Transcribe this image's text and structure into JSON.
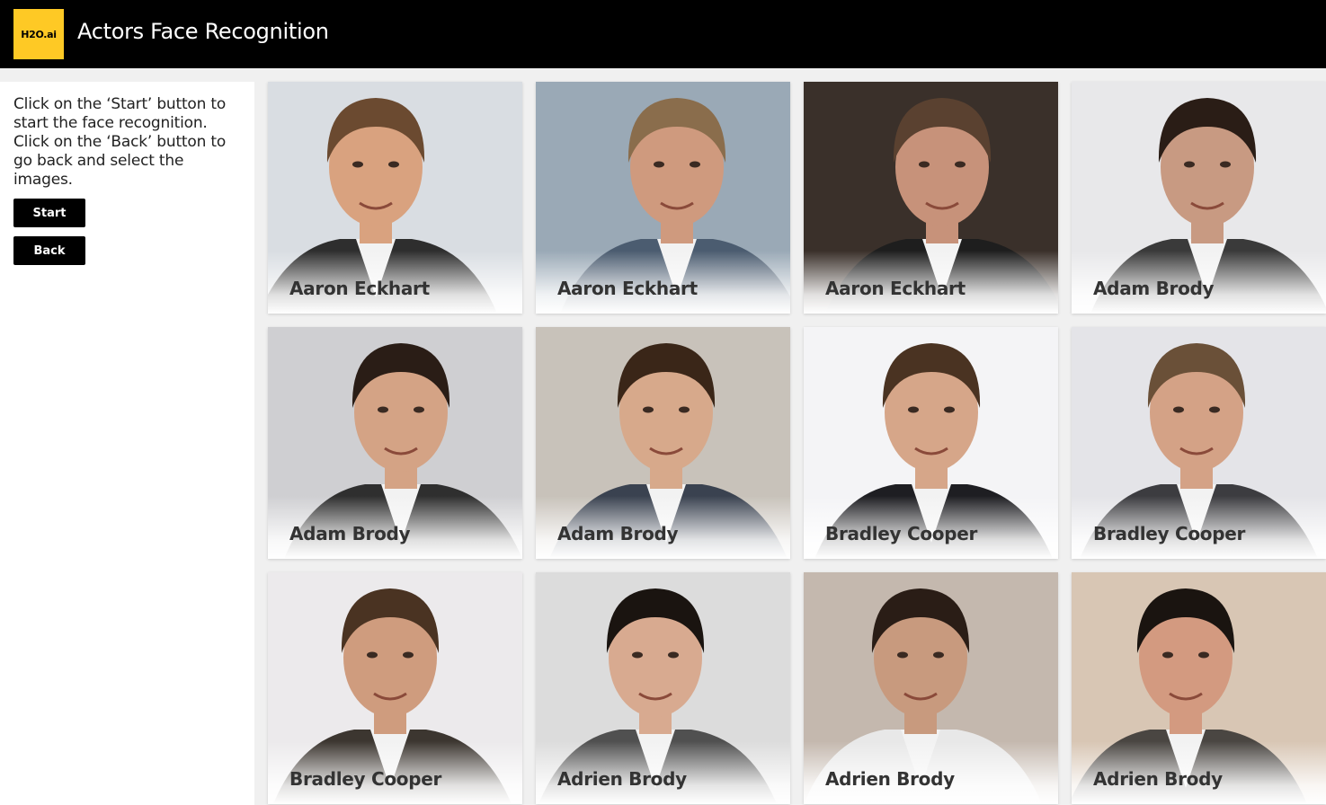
{
  "header": {
    "logo_text": "H2O.ai",
    "title": "Actors Face Recognition",
    "colors": {
      "background": "#000000",
      "logo": "#fec925"
    }
  },
  "sidebar": {
    "instructions": [
      "Click on the ‘Start’ button to start the face recognition.",
      "Click on the ‘Back’ button to go back and select the images."
    ],
    "start_label": "Start",
    "back_label": "Back"
  },
  "gallery": {
    "cards": [
      {
        "name": "Aaron Eckhart",
        "bg": "#d9dde2",
        "skin": "#d9a27f",
        "hair": "#6b4a30",
        "suit": "#2e2e2e"
      },
      {
        "name": "Aaron Eckhart",
        "bg": "#9aa9b6",
        "skin": "#cf9a7e",
        "hair": "#8a6d4c",
        "suit": "#4b5c70"
      },
      {
        "name": "Aaron Eckhart",
        "bg": "#3a302a",
        "skin": "#c7927a",
        "hair": "#5a4130",
        "suit": "#1e1e1e"
      },
      {
        "name": "Adam Brody",
        "bg": "#e8e8ea",
        "skin": "#c89a82",
        "hair": "#2a1d16",
        "suit": "#3a3a3a"
      },
      {
        "name": "Adam Brody",
        "bg": "#cfcfd2",
        "skin": "#d4a385",
        "hair": "#2a1d16",
        "suit": "#2f2f2f"
      },
      {
        "name": "Adam Brody",
        "bg": "#c8c2ba",
        "skin": "#d7a98b",
        "hair": "#3a2618",
        "suit": "#3a4250"
      },
      {
        "name": "Bradley Cooper",
        "bg": "#f4f4f6",
        "skin": "#d6a689",
        "hair": "#4a3322",
        "suit": "#1e1e22"
      },
      {
        "name": "Bradley Cooper",
        "bg": "#e4e4e8",
        "skin": "#d4a286",
        "hair": "#6a5038",
        "suit": "#3c3c40"
      },
      {
        "name": "Bradley Cooper",
        "bg": "#eceaec",
        "skin": "#cf9c7e",
        "hair": "#4a3322",
        "suit": "#3c3630"
      },
      {
        "name": "Adrien Brody",
        "bg": "#dcdcdc",
        "skin": "#d8aa90",
        "hair": "#1a1410",
        "suit": "#505050"
      },
      {
        "name": "Adrien Brody",
        "bg": "#c4b8ae",
        "skin": "#c89a7e",
        "hair": "#2a1d16",
        "suit": "#e8e8e8"
      },
      {
        "name": "Adrien Brody",
        "bg": "#d8c6b4",
        "skin": "#d39a80",
        "hair": "#1a1410",
        "suit": "#4a4642"
      }
    ]
  }
}
